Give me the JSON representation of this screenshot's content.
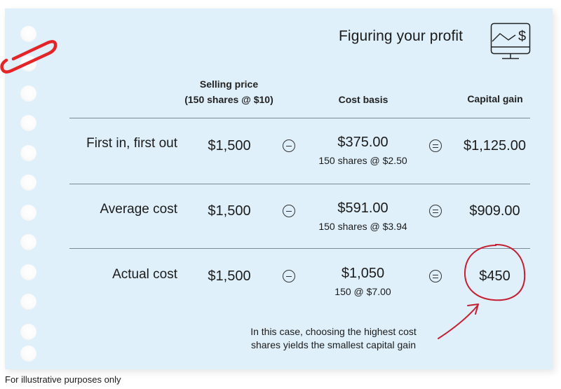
{
  "title": "Figuring your profit",
  "icons": {
    "title_icon": "monitor-chart-dollar-icon",
    "paperclip": "paperclip-icon",
    "minus": "minus-circle-icon",
    "equals": "equals-circle-icon",
    "highlight": "hand-drawn-circle",
    "arrow": "hand-drawn-arrow-icon"
  },
  "colors": {
    "paper": "#dff0fa",
    "accent_red": "#c41f33",
    "paperclip_red": "#e42528",
    "rule": "#7c8a93"
  },
  "columns": {
    "selling_price_line1": "Selling price",
    "selling_price_line2": "(150 shares @ $10)",
    "cost_basis": "Cost basis",
    "capital_gain": "Capital gain"
  },
  "rows": [
    {
      "method": "First in, first out",
      "selling_price": "$1,500",
      "cost_basis": "$375.00",
      "cost_basis_detail": "150 shares @ $2.50",
      "capital_gain": "$1,125.00"
    },
    {
      "method": "Average cost",
      "selling_price": "$1,500",
      "cost_basis": "$591.00",
      "cost_basis_detail": "150 shares @ $3.94",
      "capital_gain": "$909.00"
    },
    {
      "method": "Actual cost",
      "selling_price": "$1,500",
      "cost_basis": "$1,050",
      "cost_basis_detail": "150 @ $7.00",
      "capital_gain": "$450",
      "highlighted": true
    }
  ],
  "note": {
    "line1": "In this case, choosing the highest cost",
    "line2": "shares yields the smallest capital gain"
  },
  "footer": "For illustrative purposes only"
}
